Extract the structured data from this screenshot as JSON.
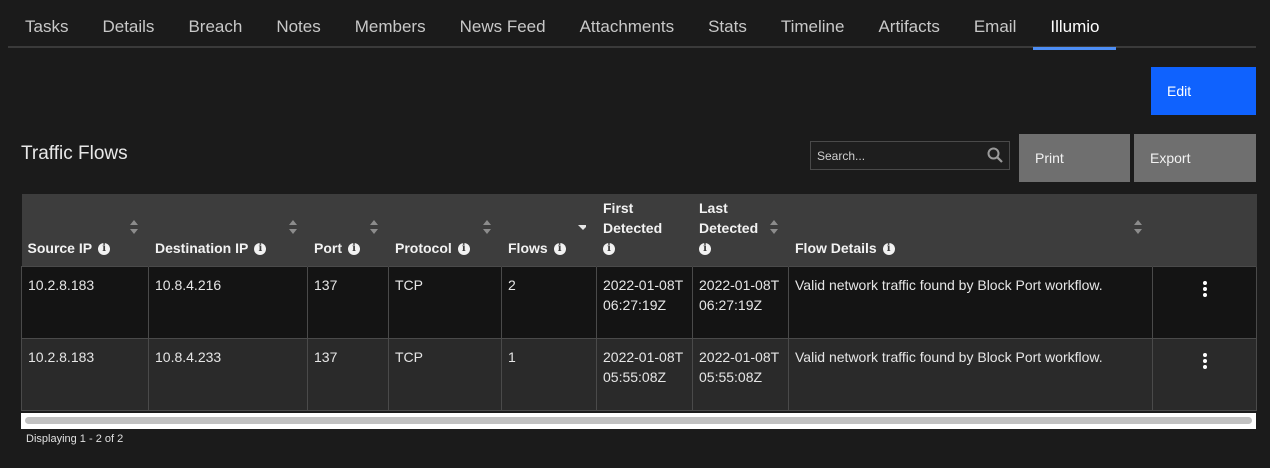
{
  "tabs": [
    "Tasks",
    "Details",
    "Breach",
    "Notes",
    "Members",
    "News Feed",
    "Attachments",
    "Stats",
    "Timeline",
    "Artifacts",
    "Email",
    "Illumio"
  ],
  "active_tab": "Illumio",
  "edit_label": "Edit",
  "section_title": "Traffic Flows",
  "search": {
    "placeholder": "Search..."
  },
  "print_label": "Print",
  "export_label": "Export",
  "columns": [
    "Source IP",
    "Destination IP",
    "Port",
    "Protocol",
    "Flows",
    "First Detected",
    "Last Detected",
    "Flow Details"
  ],
  "rows": [
    {
      "source_ip": "10.2.8.183",
      "destination_ip": "10.8.4.216",
      "port": "137",
      "protocol": "TCP",
      "flows": "2",
      "first_detected": "2022-01-08T06:27:19Z",
      "last_detected": "2022-01-08T06:27:19Z",
      "flow_details": "Valid network traffic found by Block Port workflow."
    },
    {
      "source_ip": "10.2.8.183",
      "destination_ip": "10.8.4.233",
      "port": "137",
      "protocol": "TCP",
      "flows": "1",
      "first_detected": "2022-01-08T05:55:08Z",
      "last_detected": "2022-01-08T05:55:08Z",
      "flow_details": "Valid network traffic found by Block Port workflow."
    }
  ],
  "footer": "Displaying 1 - 2 of 2",
  "colors": {
    "accent": "#0f62fe",
    "tab_underline": "#4d8ef5",
    "header_bg": "#3d3d3d",
    "button_gray": "#6f6f6f"
  },
  "icons": {
    "search": "search-icon",
    "info": "info-icon",
    "sort": "sort-icon",
    "row_menu": "kebab-menu-icon"
  }
}
